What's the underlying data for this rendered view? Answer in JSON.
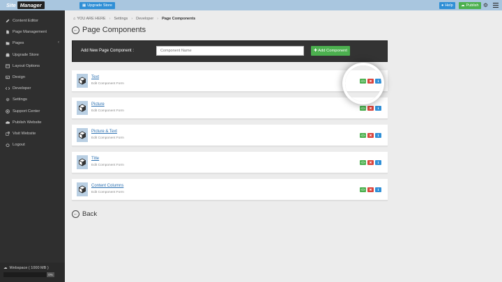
{
  "app": {
    "logo_part1": "Site",
    "logo_part2": "Manager",
    "upgrade_label": "Upgrade Store",
    "help_label": "Help",
    "publish_label": "Publish"
  },
  "sidebar": {
    "items": [
      {
        "label": "Content Editor",
        "icon": "edit-icon"
      },
      {
        "label": "Page Management",
        "icon": "page-icon"
      },
      {
        "label": "Pages",
        "icon": "folder-icon",
        "chevron": "‹"
      },
      {
        "label": "Upgrade Store",
        "icon": "store-icon"
      },
      {
        "label": "Layout Options",
        "icon": "layout-icon"
      },
      {
        "label": "Design",
        "icon": "image-icon"
      },
      {
        "label": "Developer",
        "icon": "code-icon"
      },
      {
        "label": "Settings",
        "icon": "gear-icon"
      },
      {
        "label": "Support Center",
        "icon": "support-icon"
      },
      {
        "label": "Publish Website",
        "icon": "cloud-icon"
      },
      {
        "label": "Visit Website",
        "icon": "external-icon"
      },
      {
        "label": "Logout",
        "icon": "power-icon"
      }
    ],
    "webspace_label": "Webspace ( 1000 MB )",
    "webspace_pct": "0%"
  },
  "breadcrumb": {
    "home": "YOU ARE HERE",
    "items": [
      "Settings",
      "Developer",
      "Page Components"
    ]
  },
  "page": {
    "title": "Page Components",
    "add_label": "Add New Page Component :",
    "add_placeholder": "Component Name",
    "add_button": "Add Component",
    "back_label": "Back"
  },
  "components": [
    {
      "name": "Text",
      "desc": "Edit Component Form"
    },
    {
      "name": "Picture",
      "desc": "Edit Component Form"
    },
    {
      "name": "Picture & Text",
      "desc": "Edit Component Form"
    },
    {
      "name": "Title",
      "desc": "Edit Component Form"
    },
    {
      "name": "Content Columns",
      "desc": "Edit Component Form"
    }
  ],
  "actions": {
    "code": "</>",
    "delete": "✖",
    "info": "ℹ"
  },
  "colors": {
    "green": "#4cb04f",
    "red": "#d9453d",
    "blue": "#2f8fd6",
    "topbar": "#a9c6df",
    "sidebar": "#2f2f2f"
  }
}
